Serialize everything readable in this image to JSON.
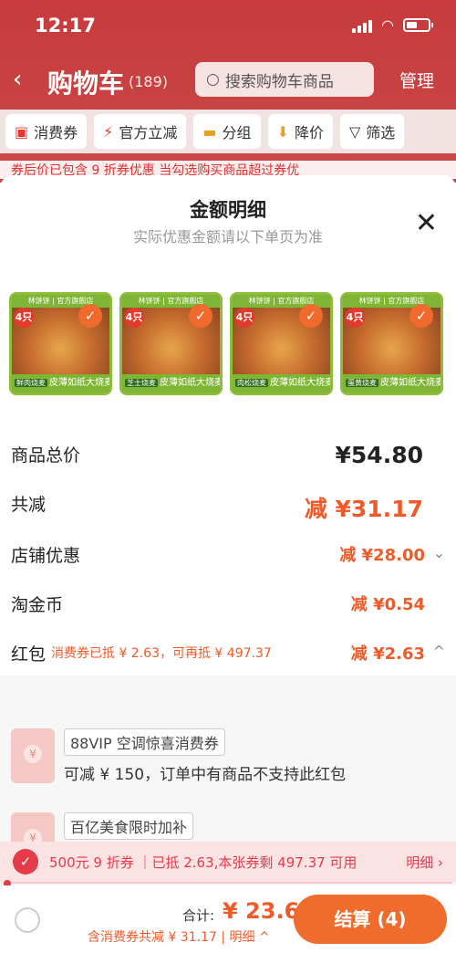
{
  "status_bar": {
    "time": "12:17"
  },
  "nav": {
    "title": "购物车",
    "count": "(189)",
    "search_placeholder": "搜索购物车商品",
    "manage_label": "管理"
  },
  "filters": [
    {
      "icon": "coupon-icon",
      "label": "消费券"
    },
    {
      "icon": "lightning-icon",
      "label": "官方立减"
    },
    {
      "icon": "folder-icon",
      "label": "分组"
    },
    {
      "icon": "arrow-down-icon",
      "label": "降价"
    },
    {
      "icon": "funnel-icon",
      "label": "筛选"
    }
  ],
  "notice": "券后价已包含 9 折券优惠   当勾选购买商品超过券优",
  "sheet": {
    "title": "金额明细",
    "subtitle": "实际优惠金额请以下单页为准"
  },
  "products": [
    {
      "shop": "林饼饼 | 官方旗舰店",
      "qty": "4只",
      "tag": "鲜肉烧麦",
      "name": "皮薄如纸大烧麦"
    },
    {
      "shop": "林饼饼 | 官方旗舰店",
      "qty": "4只",
      "tag": "芝士烧麦",
      "name": "皮薄如纸大烧麦"
    },
    {
      "shop": "林饼饼 | 官方旗舰店",
      "qty": "4只",
      "tag": "肉松烧麦",
      "name": "皮薄如纸大烧麦"
    },
    {
      "shop": "林饼饼 | 官方旗舰店",
      "qty": "4只",
      "tag": "蛋黄烧麦",
      "name": "皮薄如纸大烧麦"
    }
  ],
  "breakdown": {
    "total": {
      "label": "商品总价",
      "value": "¥54.80"
    },
    "discount": {
      "label": "共减",
      "value": "减 ¥31.17"
    },
    "shop": {
      "label": "店铺优惠",
      "value": "减 ¥28.00"
    },
    "coin": {
      "label": "淘金币",
      "value": "减 ¥0.54"
    },
    "hongbao": {
      "label": "红包",
      "note": "消费券已抵 ¥ 2.63，可再抵 ¥ 497.37",
      "value": "减 ¥2.63"
    }
  },
  "coupons": [
    {
      "tag": "88VIP 空调惊喜消费券",
      "desc": "可减 ¥ 150，订单中有商品不支持此红包"
    },
    {
      "tag": "百亿美食限时加补",
      "desc": ""
    }
  ],
  "promo": {
    "text": "500元 9 折券 ｜已抵 2.63,本张券剩 497.37 可用",
    "detail": "明细 ›"
  },
  "footer": {
    "sum_label": "合计:",
    "sum_value": "¥ 23.63",
    "note": "含消费券共减 ¥ 31.17 | 明细 ^",
    "checkout_label": "结算 (4)"
  },
  "colors": {
    "accent": "#ef6c2c",
    "header": "#c83a3c",
    "promo": "#e43a4a"
  }
}
